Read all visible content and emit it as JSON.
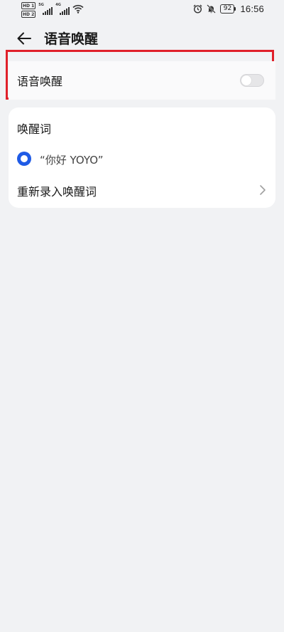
{
  "status_bar": {
    "left_badges": [
      "HD 1",
      "HD 2"
    ],
    "signal1_gen": "5G",
    "signal2_gen": "4G",
    "battery": "92",
    "time": "16:56",
    "icons": [
      "alarm-icon",
      "mute-bell-icon",
      "battery-icon"
    ]
  },
  "header": {
    "title": "语音唤醒",
    "back_icon": "arrow-left-icon"
  },
  "toggle_row": {
    "label": "语音唤醒",
    "enabled": false
  },
  "wake_word_section": {
    "title": "唤醒词",
    "option_label": "“你好 YOYO”",
    "option_selected": true,
    "rerecord_label": "重新录入唤醒词"
  },
  "colors": {
    "highlight": "#e0202a",
    "accent": "#1f5be6",
    "background": "#f1f2f4"
  }
}
